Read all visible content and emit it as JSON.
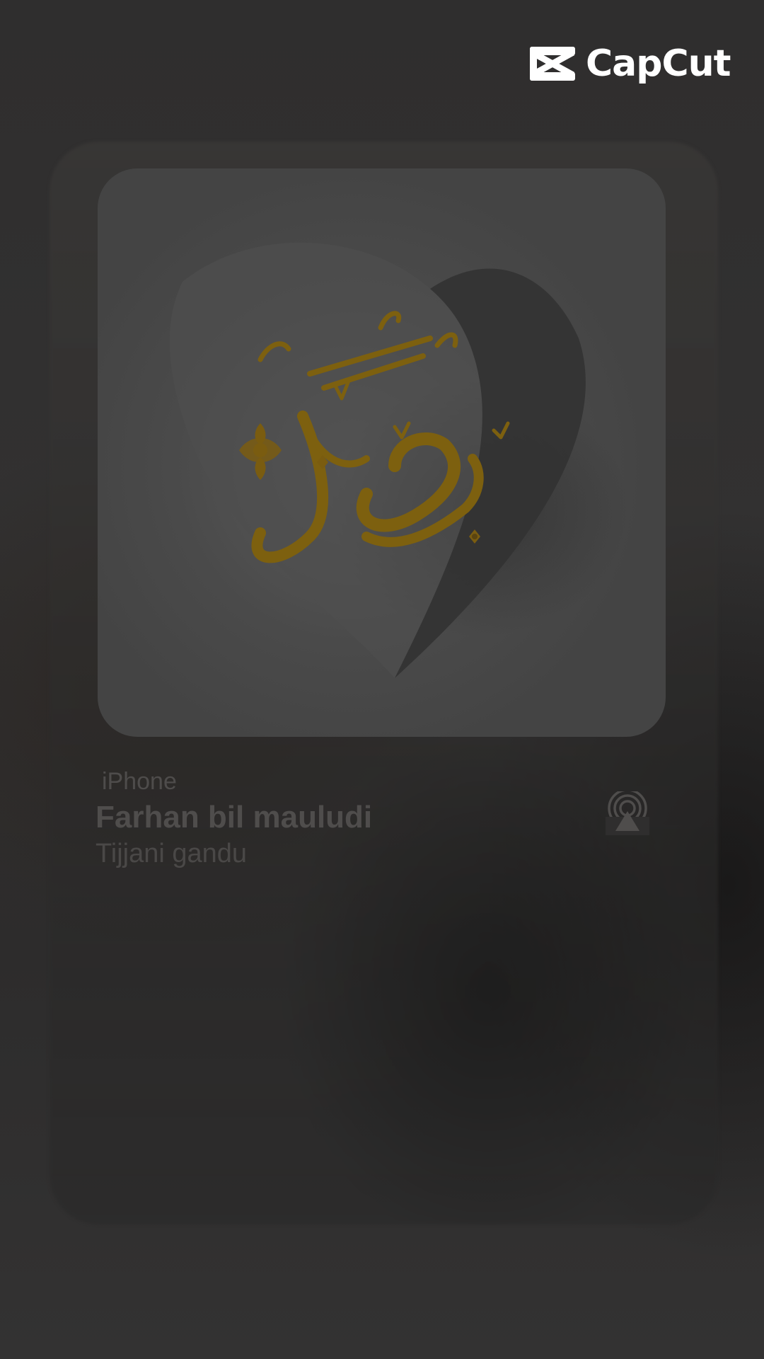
{
  "brand": {
    "name": "CapCut",
    "logo_icon": "capcut-logo-icon"
  },
  "now_playing": {
    "device": "iPhone",
    "title": "Farhan bil mauludi",
    "artist": "Tijjani gandu",
    "artwork_icon": "calligraphy-artwork",
    "output_icon": "airplay-icon"
  },
  "colors": {
    "background": "#2e2d2d",
    "calligraphy_gold": "#8a6a12",
    "text_dim": "#4e4c4b"
  }
}
